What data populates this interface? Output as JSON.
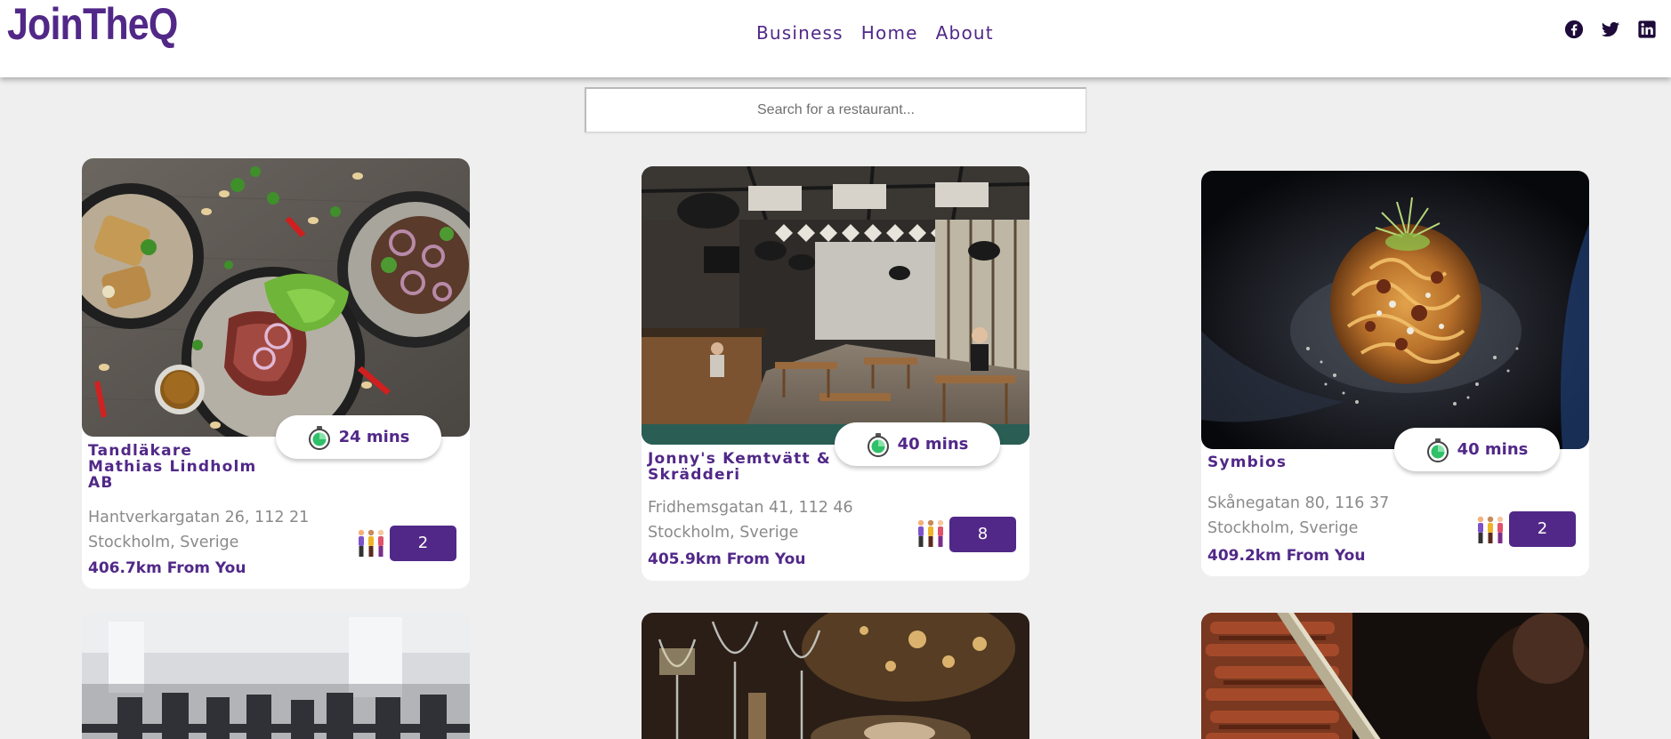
{
  "app": {
    "logo": "JoinTheQ"
  },
  "nav": {
    "business": "Business",
    "home": "Home",
    "about": "About"
  },
  "social": [
    "facebook-icon",
    "twitter-icon",
    "linkedin-icon"
  ],
  "search": {
    "placeholder": "Search for a restaurant...",
    "value": ""
  },
  "restaurants": [
    {
      "name": "Tandläkare Mathias Lindholm AB",
      "wait": "24 mins",
      "address": "Hantverkargatan 26, 112 21 Stockholm, Sverige",
      "distance": "406.7km From You",
      "queue": "2"
    },
    {
      "name": "Jonny's Kemtvätt & Skrädderi",
      "wait": "40 mins",
      "address": "Fridhemsgatan 41, 112 46 Stockholm, Sverige",
      "distance": "405.9km From You",
      "queue": "8"
    },
    {
      "name": "Symbios",
      "wait": "40 mins",
      "address": "Skånegatan 80, 116 37 Stockholm, Sverige",
      "distance": "409.2km From You",
      "queue": "2"
    }
  ],
  "colors": {
    "brand": "#512888",
    "background": "#efefef",
    "card": "#ffffff",
    "muted_text": "#8a8a8a"
  }
}
